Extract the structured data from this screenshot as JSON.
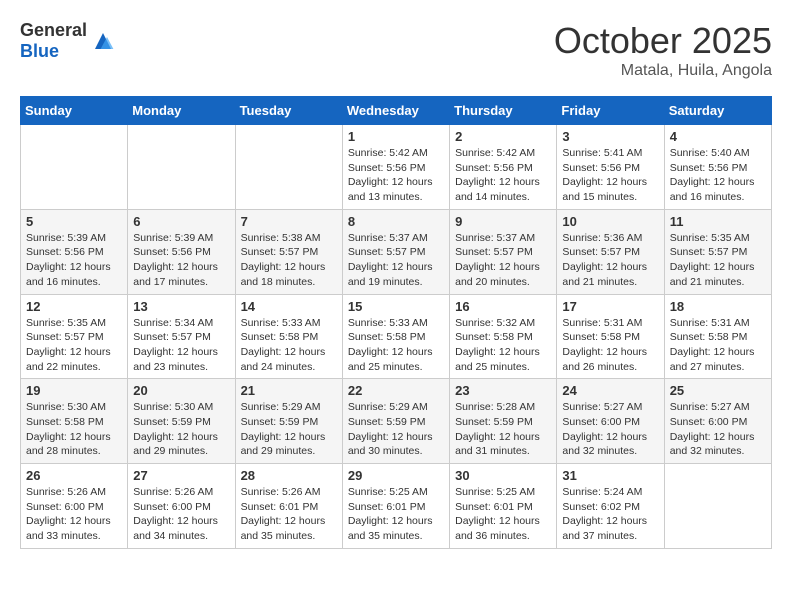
{
  "header": {
    "logo_general": "General",
    "logo_blue": "Blue",
    "month_title": "October 2025",
    "subtitle": "Matala, Huila, Angola"
  },
  "weekdays": [
    "Sunday",
    "Monday",
    "Tuesday",
    "Wednesday",
    "Thursday",
    "Friday",
    "Saturday"
  ],
  "weeks": [
    [
      {
        "day": "",
        "info": ""
      },
      {
        "day": "",
        "info": ""
      },
      {
        "day": "",
        "info": ""
      },
      {
        "day": "1",
        "info": "Sunrise: 5:42 AM\nSunset: 5:56 PM\nDaylight: 12 hours\nand 13 minutes."
      },
      {
        "day": "2",
        "info": "Sunrise: 5:42 AM\nSunset: 5:56 PM\nDaylight: 12 hours\nand 14 minutes."
      },
      {
        "day": "3",
        "info": "Sunrise: 5:41 AM\nSunset: 5:56 PM\nDaylight: 12 hours\nand 15 minutes."
      },
      {
        "day": "4",
        "info": "Sunrise: 5:40 AM\nSunset: 5:56 PM\nDaylight: 12 hours\nand 16 minutes."
      }
    ],
    [
      {
        "day": "5",
        "info": "Sunrise: 5:39 AM\nSunset: 5:56 PM\nDaylight: 12 hours\nand 16 minutes."
      },
      {
        "day": "6",
        "info": "Sunrise: 5:39 AM\nSunset: 5:56 PM\nDaylight: 12 hours\nand 17 minutes."
      },
      {
        "day": "7",
        "info": "Sunrise: 5:38 AM\nSunset: 5:57 PM\nDaylight: 12 hours\nand 18 minutes."
      },
      {
        "day": "8",
        "info": "Sunrise: 5:37 AM\nSunset: 5:57 PM\nDaylight: 12 hours\nand 19 minutes."
      },
      {
        "day": "9",
        "info": "Sunrise: 5:37 AM\nSunset: 5:57 PM\nDaylight: 12 hours\nand 20 minutes."
      },
      {
        "day": "10",
        "info": "Sunrise: 5:36 AM\nSunset: 5:57 PM\nDaylight: 12 hours\nand 21 minutes."
      },
      {
        "day": "11",
        "info": "Sunrise: 5:35 AM\nSunset: 5:57 PM\nDaylight: 12 hours\nand 21 minutes."
      }
    ],
    [
      {
        "day": "12",
        "info": "Sunrise: 5:35 AM\nSunset: 5:57 PM\nDaylight: 12 hours\nand 22 minutes."
      },
      {
        "day": "13",
        "info": "Sunrise: 5:34 AM\nSunset: 5:57 PM\nDaylight: 12 hours\nand 23 minutes."
      },
      {
        "day": "14",
        "info": "Sunrise: 5:33 AM\nSunset: 5:58 PM\nDaylight: 12 hours\nand 24 minutes."
      },
      {
        "day": "15",
        "info": "Sunrise: 5:33 AM\nSunset: 5:58 PM\nDaylight: 12 hours\nand 25 minutes."
      },
      {
        "day": "16",
        "info": "Sunrise: 5:32 AM\nSunset: 5:58 PM\nDaylight: 12 hours\nand 25 minutes."
      },
      {
        "day": "17",
        "info": "Sunrise: 5:31 AM\nSunset: 5:58 PM\nDaylight: 12 hours\nand 26 minutes."
      },
      {
        "day": "18",
        "info": "Sunrise: 5:31 AM\nSunset: 5:58 PM\nDaylight: 12 hours\nand 27 minutes."
      }
    ],
    [
      {
        "day": "19",
        "info": "Sunrise: 5:30 AM\nSunset: 5:58 PM\nDaylight: 12 hours\nand 28 minutes."
      },
      {
        "day": "20",
        "info": "Sunrise: 5:30 AM\nSunset: 5:59 PM\nDaylight: 12 hours\nand 29 minutes."
      },
      {
        "day": "21",
        "info": "Sunrise: 5:29 AM\nSunset: 5:59 PM\nDaylight: 12 hours\nand 29 minutes."
      },
      {
        "day": "22",
        "info": "Sunrise: 5:29 AM\nSunset: 5:59 PM\nDaylight: 12 hours\nand 30 minutes."
      },
      {
        "day": "23",
        "info": "Sunrise: 5:28 AM\nSunset: 5:59 PM\nDaylight: 12 hours\nand 31 minutes."
      },
      {
        "day": "24",
        "info": "Sunrise: 5:27 AM\nSunset: 6:00 PM\nDaylight: 12 hours\nand 32 minutes."
      },
      {
        "day": "25",
        "info": "Sunrise: 5:27 AM\nSunset: 6:00 PM\nDaylight: 12 hours\nand 32 minutes."
      }
    ],
    [
      {
        "day": "26",
        "info": "Sunrise: 5:26 AM\nSunset: 6:00 PM\nDaylight: 12 hours\nand 33 minutes."
      },
      {
        "day": "27",
        "info": "Sunrise: 5:26 AM\nSunset: 6:00 PM\nDaylight: 12 hours\nand 34 minutes."
      },
      {
        "day": "28",
        "info": "Sunrise: 5:26 AM\nSunset: 6:01 PM\nDaylight: 12 hours\nand 35 minutes."
      },
      {
        "day": "29",
        "info": "Sunrise: 5:25 AM\nSunset: 6:01 PM\nDaylight: 12 hours\nand 35 minutes."
      },
      {
        "day": "30",
        "info": "Sunrise: 5:25 AM\nSunset: 6:01 PM\nDaylight: 12 hours\nand 36 minutes."
      },
      {
        "day": "31",
        "info": "Sunrise: 5:24 AM\nSunset: 6:02 PM\nDaylight: 12 hours\nand 37 minutes."
      },
      {
        "day": "",
        "info": ""
      }
    ]
  ]
}
